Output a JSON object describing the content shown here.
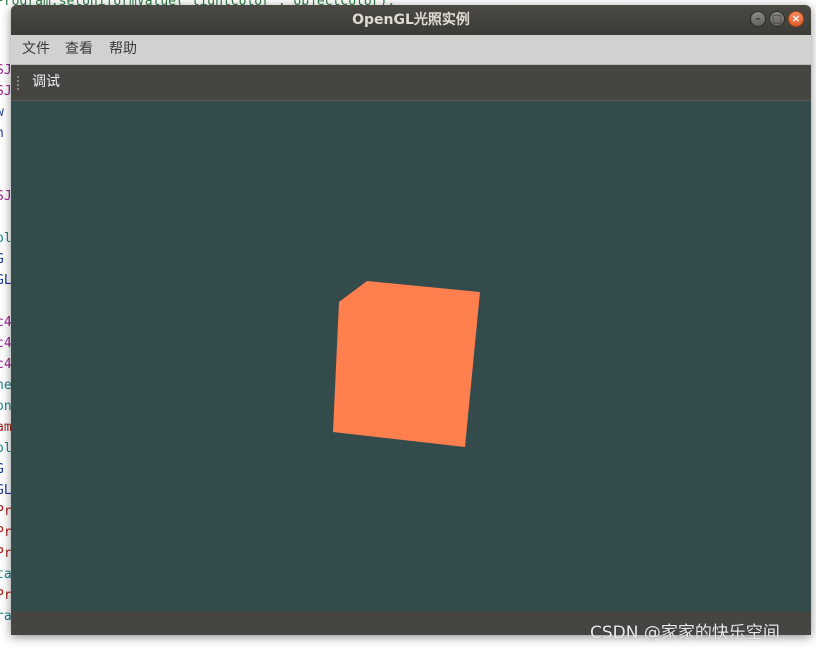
{
  "background_code": {
    "top_line": "Program.setUniformValue(\"lightColor\", objectColor);",
    "fragments": [
      {
        "text": "SJ",
        "color": "#9b2393"
      },
      {
        "text": "SJ",
        "color": "#9b2393"
      },
      {
        "text": "w",
        "color": "#1f3a93"
      },
      {
        "text": "h",
        "color": "#1f3a93"
      },
      {
        "text": "SJ",
        "color": "#9b2393"
      },
      {
        "text": "ol",
        "color": "#17838a"
      },
      {
        "text": "G",
        "color": "#1f3a93"
      },
      {
        "text": "GL",
        "color": "#1f3a93"
      },
      {
        "text": "c4",
        "color": "#9b2393"
      },
      {
        "text": "c4",
        "color": "#9b2393"
      },
      {
        "text": "c4",
        "color": "#9b2393"
      },
      {
        "text": "ne",
        "color": "#17838a"
      },
      {
        "text": "on",
        "color": "#17838a"
      },
      {
        "text": "am",
        "color": "#a8201a"
      },
      {
        "text": "ol",
        "color": "#17838a"
      },
      {
        "text": "G",
        "color": "#1f3a93"
      },
      {
        "text": "GL",
        "color": "#1f3a93"
      },
      {
        "text": "Pr",
        "color": "#a8201a"
      },
      {
        "text": "Pr",
        "color": "#a8201a"
      },
      {
        "text": "Pr",
        "color": "#a8201a"
      },
      {
        "text": "ta",
        "color": "#17838a"
      },
      {
        "text": "Pr",
        "color": "#a8201a"
      },
      {
        "text": "ra",
        "color": "#17838a"
      }
    ]
  },
  "window": {
    "title": "OpenGL光照实例",
    "controls": [
      "minimize",
      "maximize",
      "close"
    ]
  },
  "menubar": {
    "items": [
      "文件",
      "查看",
      "帮助"
    ]
  },
  "toolbar": {
    "button_label": "调试"
  },
  "viewport": {
    "clear_color": "#344b4c",
    "object": "cube",
    "object_color": "#ff7f4f"
  },
  "watermark": "CSDN @家家的快乐空间"
}
